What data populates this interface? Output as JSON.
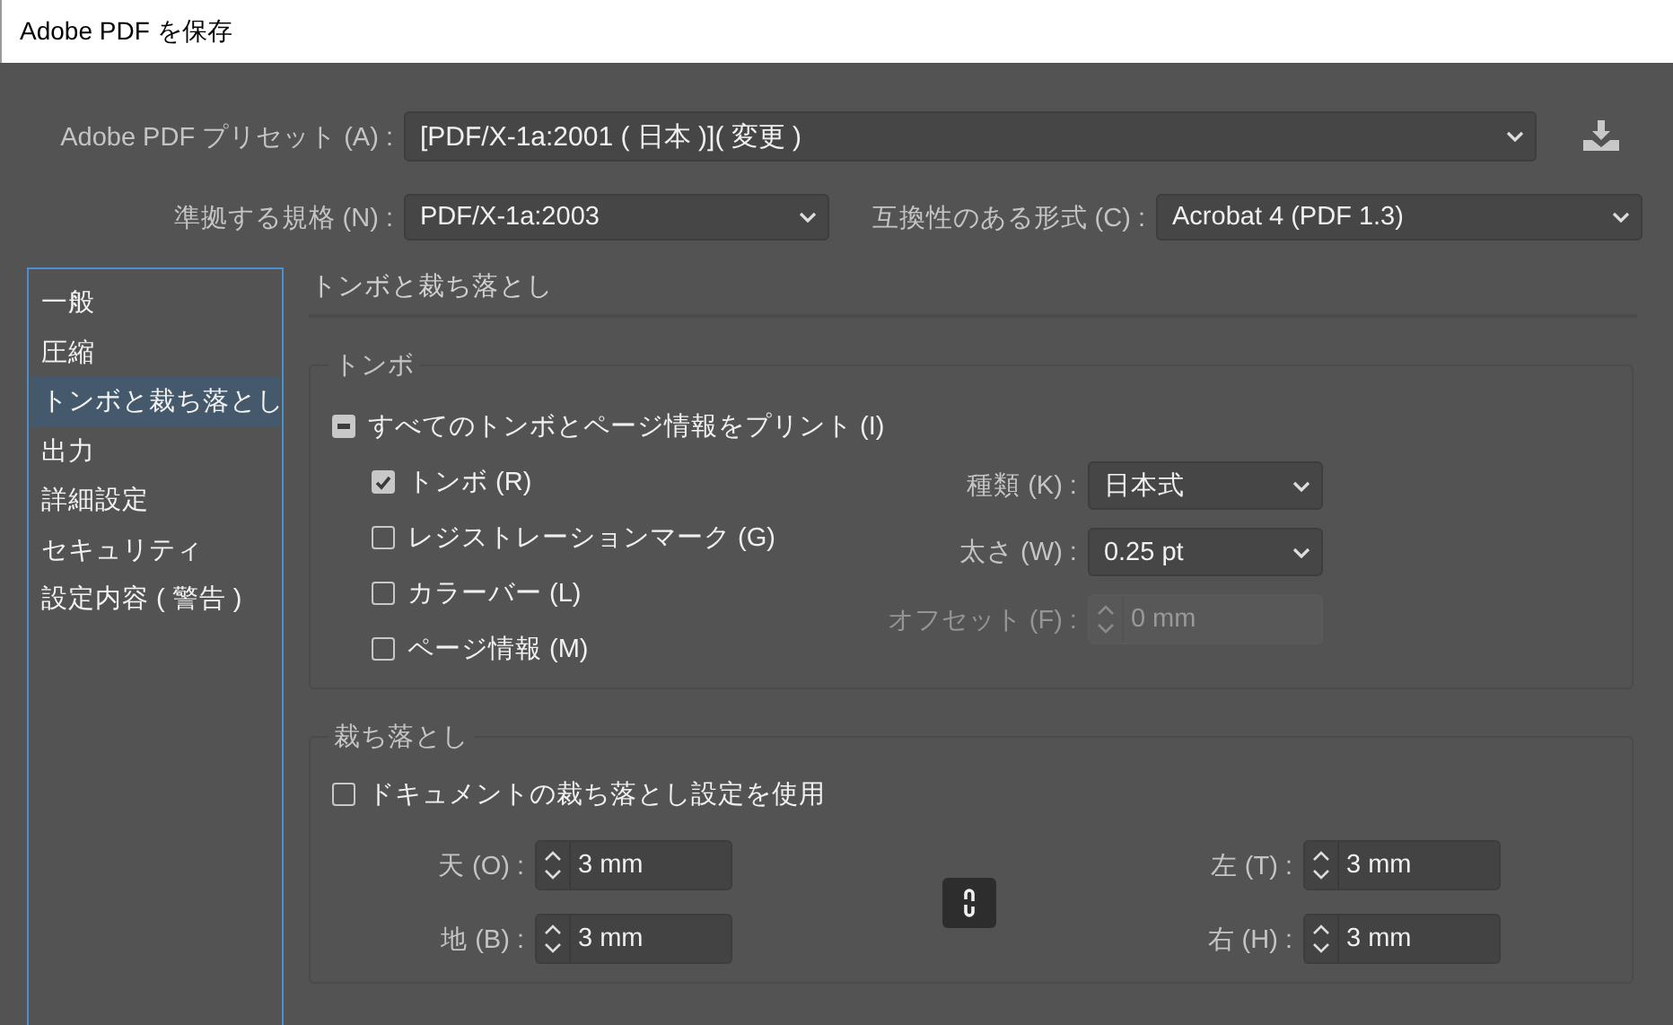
{
  "window": {
    "title": "Adobe PDF を保存"
  },
  "preset": {
    "label": "Adobe PDF プリセット (A) :",
    "value": "[PDF/X-1a:2001 ( 日本 )]( 変更 )"
  },
  "standard": {
    "label": "準拠する規格 (N) :",
    "value": "PDF/X-1a:2003"
  },
  "compatibility": {
    "label": "互換性のある形式 (C) :",
    "value": "Acrobat 4 (PDF 1.3)"
  },
  "sidebar": {
    "items": [
      {
        "label": "一般",
        "selected": false
      },
      {
        "label": "圧縮",
        "selected": false
      },
      {
        "label": "トンボと裁ち落とし",
        "selected": true
      },
      {
        "label": "出力",
        "selected": false
      },
      {
        "label": "詳細設定",
        "selected": false
      },
      {
        "label": "セキュリティ",
        "selected": false
      },
      {
        "label": "設定内容 ( 警告 )",
        "selected": false
      }
    ]
  },
  "section_title": "トンボと裁ち落とし",
  "marks": {
    "legend": "トンボ",
    "all": {
      "label": "すべてのトンボとページ情報をプリント (I)",
      "mixed": true
    },
    "options": [
      {
        "label": "トンボ (R)",
        "checked": true
      },
      {
        "label": "レジストレーションマーク (G)",
        "checked": false
      },
      {
        "label": "カラーバー (L)",
        "checked": false
      },
      {
        "label": "ページ情報 (M)",
        "checked": false
      }
    ],
    "settings": [
      {
        "kind": "select",
        "label": "種類 (K) :",
        "value": "日本式",
        "disabled": false
      },
      {
        "kind": "select",
        "label": "太さ (W) :",
        "value": "0.25 pt",
        "disabled": false
      },
      {
        "kind": "spinner",
        "label": "オフセット (F) :",
        "value": "0 mm",
        "disabled": true
      }
    ]
  },
  "bleed": {
    "legend": "裁ち落とし",
    "use_document": {
      "label": "ドキュメントの裁ち落とし設定を使用",
      "checked": false
    },
    "left_fields": [
      {
        "label": "天 (O) :",
        "value": "3 mm"
      },
      {
        "label": "地 (B) :",
        "value": "3 mm"
      }
    ],
    "link": {
      "on": true
    },
    "right_fields": [
      {
        "label": "左 (T) :",
        "value": "3 mm"
      },
      {
        "label": "右 (H) :",
        "value": "3 mm"
      }
    ]
  }
}
